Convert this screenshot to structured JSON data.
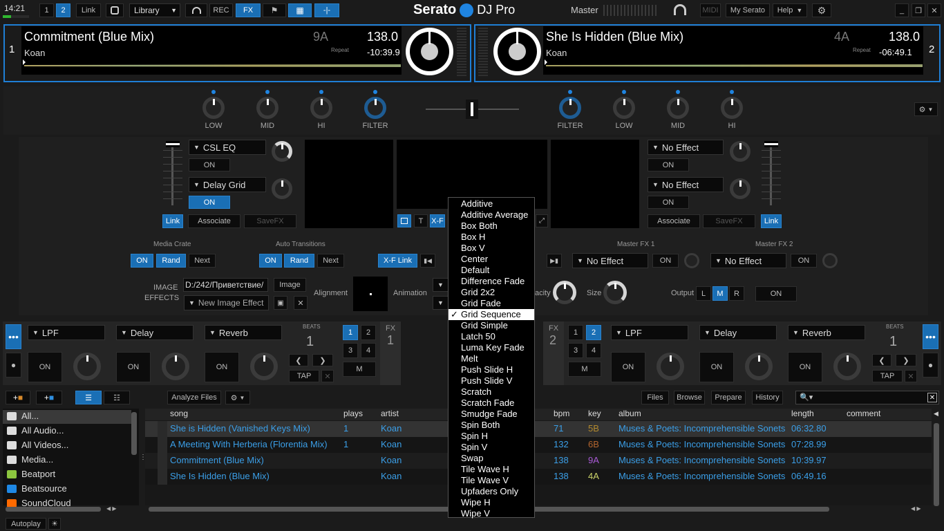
{
  "topbar": {
    "time": "14:21",
    "deck1": "1",
    "deck2": "2",
    "link": "Link",
    "library": "Library",
    "rec": "REC",
    "fx": "FX",
    "brand": "Serato",
    "brand2": "DJ Pro",
    "master": "Master",
    "midi": "MIDI",
    "my_serato": "My Serato",
    "help": "Help"
  },
  "deck_left": {
    "number": "1",
    "title": "Commitment (Blue Mix)",
    "artist": "Koan",
    "key": "9A",
    "bpm": "138.0",
    "repeat": "Repeat",
    "time": "-10:39.9"
  },
  "deck_right": {
    "number": "2",
    "title": "She Is Hidden (Blue Mix)",
    "artist": "Koan",
    "key": "4A",
    "bpm": "138.0",
    "repeat": "Repeat",
    "time": "-06:49.1"
  },
  "mixer": {
    "low": "LOW",
    "mid": "MID",
    "hi": "HI",
    "filter": "FILTER"
  },
  "video": {
    "left_fx1": "CSL EQ",
    "left_fx2": "Delay Grid",
    "on": "ON",
    "link": "Link",
    "associate": "Associate",
    "savefx": "SaveFX",
    "right_fx1": "No Effect",
    "right_fx2": "No Effect",
    "xf": "X-F",
    "t": "T",
    "media_crate": "Media Crate",
    "auto_transitions": "Auto Transitions",
    "rand": "Rand",
    "next": "Next",
    "xf_link": "X-F Link",
    "master_fx1": "Master FX 1",
    "master_fx2": "Master FX 2",
    "no_effect": "No Effect",
    "image_effects_1": "IMAGE",
    "image_effects_2": "EFFECTS",
    "image_path": "D:/242/Приветствие/",
    "image_btn": "Image",
    "new_image_effect": "New Image Effect",
    "alignment": "Alignment",
    "animation": "Animation",
    "opacity": "acity",
    "size": "Size",
    "output": "Output",
    "l": "L",
    "m": "M",
    "r": "R"
  },
  "fx_left": {
    "unit1": "LPF",
    "unit2": "Delay",
    "unit3": "Reverb",
    "beats_label": "BEATS",
    "beats": "1",
    "fx_label": "FX",
    "fx_num": "1",
    "b1": "1",
    "b2": "2",
    "b3": "3",
    "b4": "4",
    "m": "M",
    "tap": "TAP",
    "on": "ON"
  },
  "fx_right": {
    "unit1": "LPF",
    "unit2": "Delay",
    "unit3": "Reverb",
    "beats_label": "BEATS",
    "beats": "1",
    "fx_label": "FX",
    "fx_num": "2",
    "b1": "1",
    "b2": "2",
    "b3": "3",
    "b4": "4",
    "m": "M",
    "tap": "TAP",
    "on": "ON"
  },
  "library": {
    "analyze": "Analyze Files",
    "files": "Files",
    "browse": "Browse",
    "prepare": "Prepare",
    "history": "History",
    "autoplay": "Autoplay",
    "sidebar": [
      {
        "label": "All...",
        "icon": "gear-icon"
      },
      {
        "label": "All Audio...",
        "icon": "speaker-icon"
      },
      {
        "label": "All Videos...",
        "icon": "film-icon"
      },
      {
        "label": "Media...",
        "icon": "film-icon"
      },
      {
        "label": "Beatport",
        "icon": "beatport-icon"
      },
      {
        "label": "Beatsource",
        "icon": "beatsource-icon"
      },
      {
        "label": "SoundCloud",
        "icon": "soundcloud-icon"
      }
    ],
    "columns": [
      "song",
      "plays",
      "artist",
      "bpm",
      "key",
      "album",
      "length",
      "comment"
    ],
    "rows": [
      {
        "song": "She is Hidden (Vanished Keys Mix)",
        "plays": "1",
        "artist": "Koan",
        "bpm": "71",
        "key": "5B",
        "album": "Muses & Poets: Incomprehensible Sonets",
        "length": "06:32.80"
      },
      {
        "song": "A Meeting With Herberia (Florentia Mix)",
        "plays": "1",
        "artist": "Koan",
        "bpm": "132",
        "key": "6B",
        "album": "Muses & Poets: Incomprehensible Sonets",
        "length": "07:28.99"
      },
      {
        "song": "Commitment (Blue Mix)",
        "plays": "",
        "artist": "Koan",
        "bpm": "138",
        "key": "9A",
        "album": "Muses & Poets: Incomprehensible Sonets",
        "length": "10:39.97"
      },
      {
        "song": "She Is Hidden (Blue Mix)",
        "plays": "",
        "artist": "Koan",
        "bpm": "138",
        "key": "4A",
        "album": "Muses & Poets: Incomprehensible Sonets",
        "length": "06:49.16"
      }
    ],
    "key_colors": {
      "5B": "#b38a2e",
      "6B": "#b3652e",
      "9A": "#a95ad6",
      "4A": "#cbd36a"
    }
  },
  "menu": {
    "selected": "Grid Sequence",
    "items": [
      "Additive",
      "Additive Average",
      "Box Both",
      "Box H",
      "Box V",
      "Center",
      "Default",
      "Difference Fade",
      "Grid 2x2",
      "Grid Fade",
      "Grid Sequence",
      "Grid Simple",
      "Latch 50",
      "Luma Key Fade",
      "Melt",
      "Push Slide H",
      "Push Slide V",
      "Scratch",
      "Scratch Fade",
      "Smudge Fade",
      "Spin Both",
      "Spin H",
      "Spin V",
      "Swap",
      "Tile Wave H",
      "Tile Wave V",
      "Upfaders Only",
      "Wipe H",
      "Wipe V"
    ]
  },
  "colors": {
    "accent": "#1a6fb5",
    "link_text": "#3b9fe8",
    "bg": "#1b1b1b"
  }
}
